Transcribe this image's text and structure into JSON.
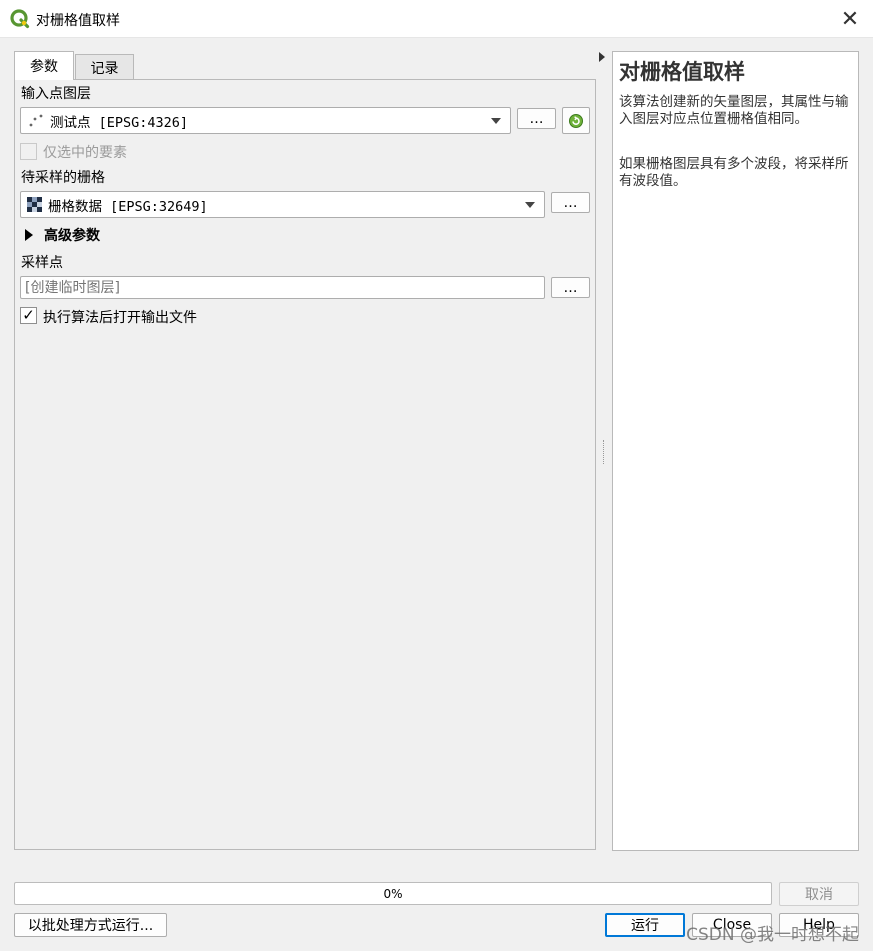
{
  "window": {
    "title": "对栅格值取样"
  },
  "tabs": [
    {
      "label": "参数"
    },
    {
      "label": "记录"
    }
  ],
  "form": {
    "input_layer_label": "输入点图层",
    "input_layer_value": "测试点 [EPSG:4326]",
    "selected_only_label": "仅选中的要素",
    "raster_label": "待采样的栅格",
    "raster_value": "栅格数据 [EPSG:32649]",
    "advanced_label": "高级参数",
    "sample_points_label": "采样点",
    "sample_points_placeholder": "[创建临时图层]",
    "open_output_label": "执行算法后打开输出文件",
    "browse_label": "…"
  },
  "help": {
    "title": "对栅格值取样",
    "para1": "该算法创建新的矢量图层，其属性与输入图层对应点位置栅格值相同。",
    "para2": "如果栅格图层具有多个波段，将采样所有波段值。"
  },
  "footer": {
    "progress_text": "0%",
    "progress_value": 0,
    "cancel_label": "取消",
    "batch_label": "以批处理方式运行...",
    "run_label": "运行",
    "close_label": "Close",
    "help_label": "Help"
  },
  "watermark": "CSDN @我一时想不起",
  "colors": {
    "qgis_green": "#589632",
    "qgis_yellow": "#eec90d"
  }
}
